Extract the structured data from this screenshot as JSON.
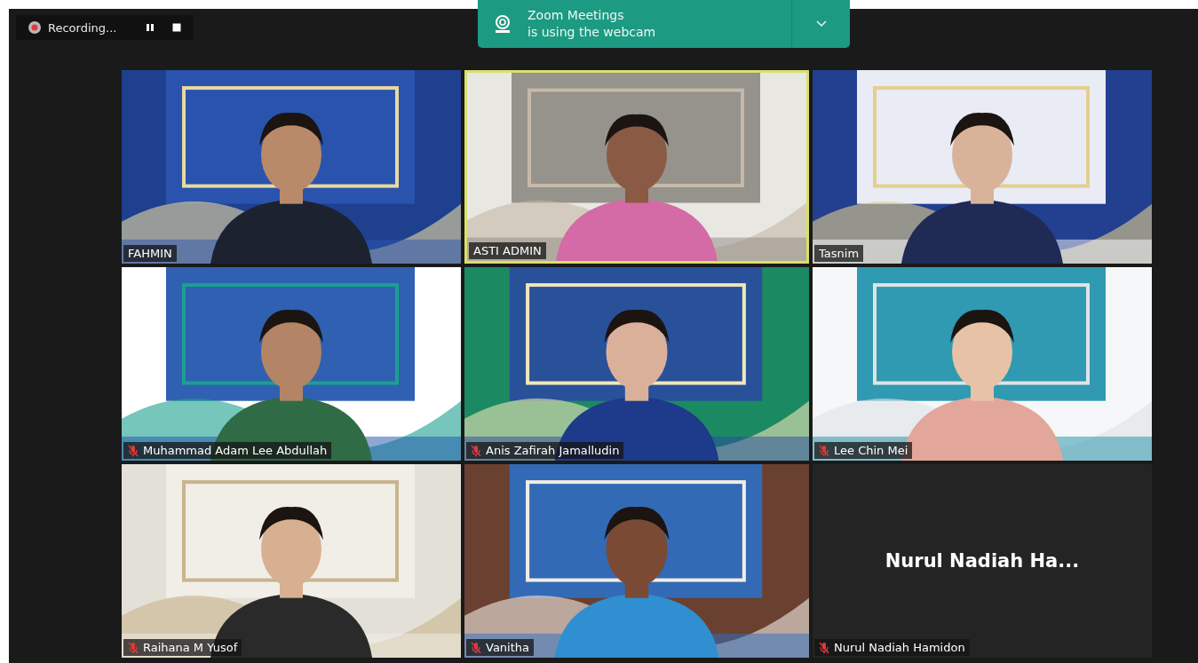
{
  "recording_bar": {
    "status": "Recording..."
  },
  "notification": {
    "title": "Zoom Meetings",
    "message": "is using the webcam"
  },
  "tiles": [
    {
      "kind": "video",
      "name": "FAHMIN",
      "muted": false,
      "active": false
    },
    {
      "kind": "video",
      "name": "ASTI ADMIN",
      "muted": false,
      "active": true
    },
    {
      "kind": "video",
      "name": "Tasnim",
      "muted": false,
      "active": false
    },
    {
      "kind": "video",
      "name": "Muhammad Adam Lee Abdullah",
      "muted": true,
      "active": false
    },
    {
      "kind": "video",
      "name": "Anis Zafirah Jamalludin",
      "muted": true,
      "active": false
    },
    {
      "kind": "video",
      "name": "Lee Chin Mei",
      "muted": true,
      "active": false
    },
    {
      "kind": "video",
      "name": "Raihana M Yusof",
      "muted": true,
      "active": false
    },
    {
      "kind": "video",
      "name": "Vanitha",
      "muted": true,
      "active": false
    },
    {
      "kind": "avatar",
      "display_name": "Nurul Nadiah Ha...",
      "name": "Nurul Nadiah Hamidon",
      "muted": true,
      "active": false
    }
  ]
}
